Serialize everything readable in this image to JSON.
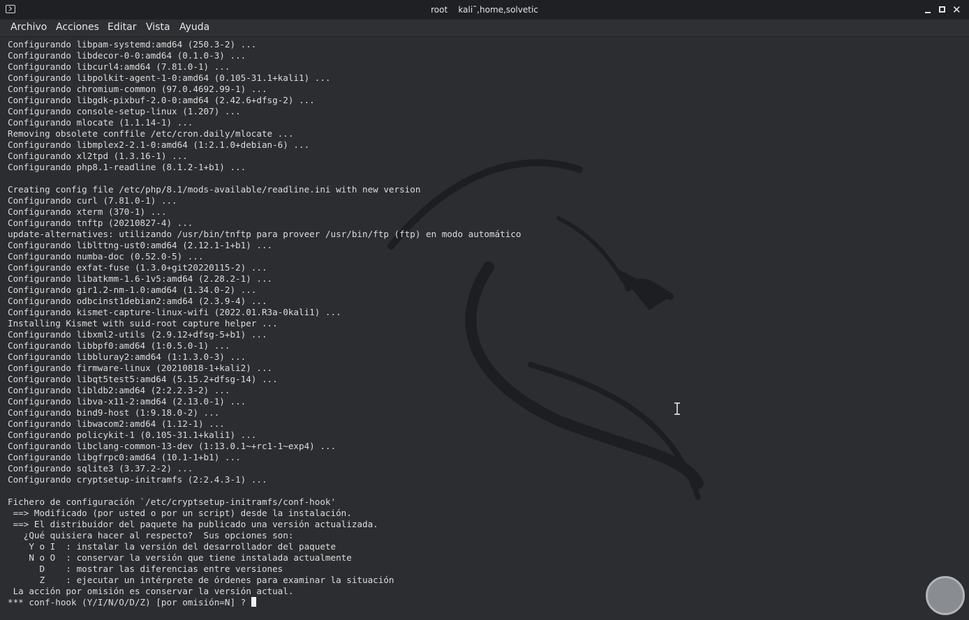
{
  "window": {
    "title": "root    kali˜,home,solvetic",
    "terminal_icon": "terminal-icon",
    "controls": [
      "minimize-icon",
      "maximize-icon",
      "close-icon"
    ]
  },
  "menu": [
    "Archivo",
    "Acciones",
    "Editar",
    "Vista",
    "Ayuda"
  ],
  "terminal": {
    "lines": [
      "Configurando libpam-systemd:amd64 (250.3-2) ...",
      "Configurando libdecor-0-0:amd64 (0.1.0-3) ...",
      "Configurando libcurl4:amd64 (7.81.0-1) ...",
      "Configurando libpolkit-agent-1-0:amd64 (0.105-31.1+kali1) ...",
      "Configurando chromium-common (97.0.4692.99-1) ...",
      "Configurando libgdk-pixbuf-2.0-0:amd64 (2.42.6+dfsg-2) ...",
      "Configurando console-setup-linux (1.207) ...",
      "Configurando mlocate (1.1.14-1) ...",
      "Removing obsolete conffile /etc/cron.daily/mlocate ...",
      "Configurando libmplex2-2.1-0:amd64 (1:2.1.0+debian-6) ...",
      "Configurando xl2tpd (1.3.16-1) ...",
      "Configurando php8.1-readline (8.1.2-1+b1) ...",
      "",
      "Creating config file /etc/php/8.1/mods-available/readline.ini with new version",
      "Configurando curl (7.81.0-1) ...",
      "Configurando xterm (370-1) ...",
      "Configurando tnftp (20210827-4) ...",
      "update-alternatives: utilizando /usr/bin/tnftp para proveer /usr/bin/ftp (ftp) en modo automático",
      "Configurando liblttng-ust0:amd64 (2.12.1-1+b1) ...",
      "Configurando numba-doc (0.52.0-5) ...",
      "Configurando exfat-fuse (1.3.0+git20220115-2) ...",
      "Configurando libatkmm-1.6-1v5:amd64 (2.28.2-1) ...",
      "Configurando gir1.2-nm-1.0:amd64 (1.34.0-2) ...",
      "Configurando odbcinst1debian2:amd64 (2.3.9-4) ...",
      "Configurando kismet-capture-linux-wifi (2022.01.R3a-0kali1) ...",
      "Installing Kismet with suid-root capture helper ...",
      "Configurando libxml2-utils (2.9.12+dfsg-5+b1) ...",
      "Configurando libbpf0:amd64 (1:0.5.0-1) ...",
      "Configurando libbluray2:amd64 (1:1.3.0-3) ...",
      "Configurando firmware-linux (20210818-1+kali2) ...",
      "Configurando libqt5test5:amd64 (5.15.2+dfsg-14) ...",
      "Configurando libldb2:amd64 (2:2.2.3-2) ...",
      "Configurando libva-x11-2:amd64 (2.13.0-1) ...",
      "Configurando bind9-host (1:9.18.0-2) ...",
      "Configurando libwacom2:amd64 (1.12-1) ...",
      "Configurando policykit-1 (0.105-31.1+kali1) ...",
      "Configurando libclang-common-13-dev (1:13.0.1~+rc1-1~exp4) ...",
      "Configurando libgfrpc0:amd64 (10.1-1+b1) ...",
      "Configurando sqlite3 (3.37.2-2) ...",
      "Configurando cryptsetup-initramfs (2:2.4.3-1) ...",
      "",
      "Fichero de configuración `/etc/cryptsetup-initramfs/conf-hook'",
      " ==> Modificado (por usted o por un script) desde la instalación.",
      " ==> El distribuidor del paquete ha publicado una versión actualizada.",
      "   ¿Qué quisiera hacer al respecto?  Sus opciones son:",
      "    Y o I  : instalar la versión del desarrollador del paquete",
      "    N o O  : conservar la versión que tiene instalada actualmente",
      "      D    : mostrar las diferencias entre versiones",
      "      Z    : ejecutar un intérprete de órdenes para examinar la situación",
      " La acción por omisión es conservar la versión actual."
    ],
    "prompt": "*** conf-hook (Y/I/N/O/D/Z) [por omisión=N] ? ",
    "background_color": "#2c2d30",
    "text_color": "#dcdcdc"
  }
}
